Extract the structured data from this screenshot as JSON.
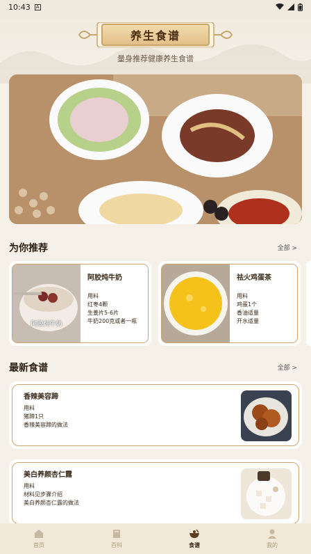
{
  "status": {
    "time": "10:43",
    "app_badge": "A"
  },
  "header": {
    "title": "养生食谱",
    "subtitle": "量身推荐健康养生食谱"
  },
  "recommended": {
    "title": "为你推荐",
    "more": "全部 >",
    "cards": [
      {
        "name": "阿胶炖牛奶",
        "image_caption": "阿胶炖牛奶",
        "lines": [
          "用料",
          "红枣4颗",
          "生姜片5-6片",
          "牛奶200克或者一瓶"
        ]
      },
      {
        "name": "祛火鸡蛋茶",
        "lines": [
          "用料",
          "鸡蛋1个",
          "香油适量",
          "开水适量"
        ]
      }
    ]
  },
  "latest": {
    "title": "最新食谱",
    "more": "全部 >",
    "cards": [
      {
        "name": "香辣美容蹄",
        "lines": [
          "用料",
          "猪蹄1只",
          "香辣美容蹄的做法"
        ]
      },
      {
        "name": "美白养颜杏仁露",
        "lines": [
          "用料",
          "材料见步骤介绍",
          "美白养颜杏仁露的做法"
        ]
      }
    ]
  },
  "tabs": [
    {
      "label": "首页",
      "icon": "home-icon",
      "active": false
    },
    {
      "label": "百科",
      "icon": "book-icon",
      "active": false
    },
    {
      "label": "食谱",
      "icon": "bowl-icon",
      "active": true
    },
    {
      "label": "我的",
      "icon": "user-icon",
      "active": false
    }
  ],
  "colors": {
    "accent": "#c9a56c",
    "background": "#f6f1e8",
    "tabbar": "#f1e8d8"
  }
}
